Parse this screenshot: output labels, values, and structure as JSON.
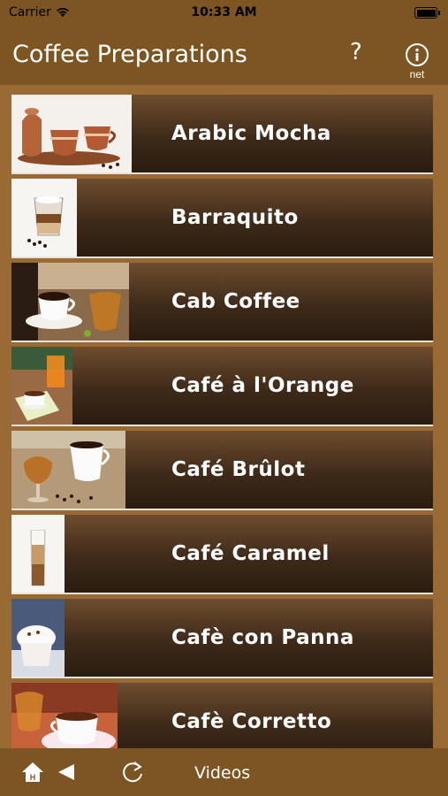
{
  "status_bar": {
    "carrier": "Carrier",
    "time": "10:33 AM",
    "battery_level": 1.0
  },
  "nav_bar": {
    "title": "Coffee Preparations",
    "help_label": "?",
    "info_caption": "net",
    "info_icon": "info-circle-icon"
  },
  "rows": [
    {
      "label": "Arabic Mocha"
    },
    {
      "label": "Barraquito"
    },
    {
      "label": "Cab Coffee"
    },
    {
      "label": "Café à l'Orange"
    },
    {
      "label": "Café Brûlot"
    },
    {
      "label": "Café Caramel"
    },
    {
      "label": "Cafè con Panna"
    },
    {
      "label": "Cafè Corretto"
    }
  ],
  "tab_bar": {
    "home_icon": "home-icon",
    "back_icon": "back-arrow-icon",
    "reload_icon": "reload-icon",
    "videos_label": "Videos"
  },
  "colors": {
    "bar": "#7d5522",
    "background": "#9a6a35",
    "row_dark": "#2a1c10"
  }
}
